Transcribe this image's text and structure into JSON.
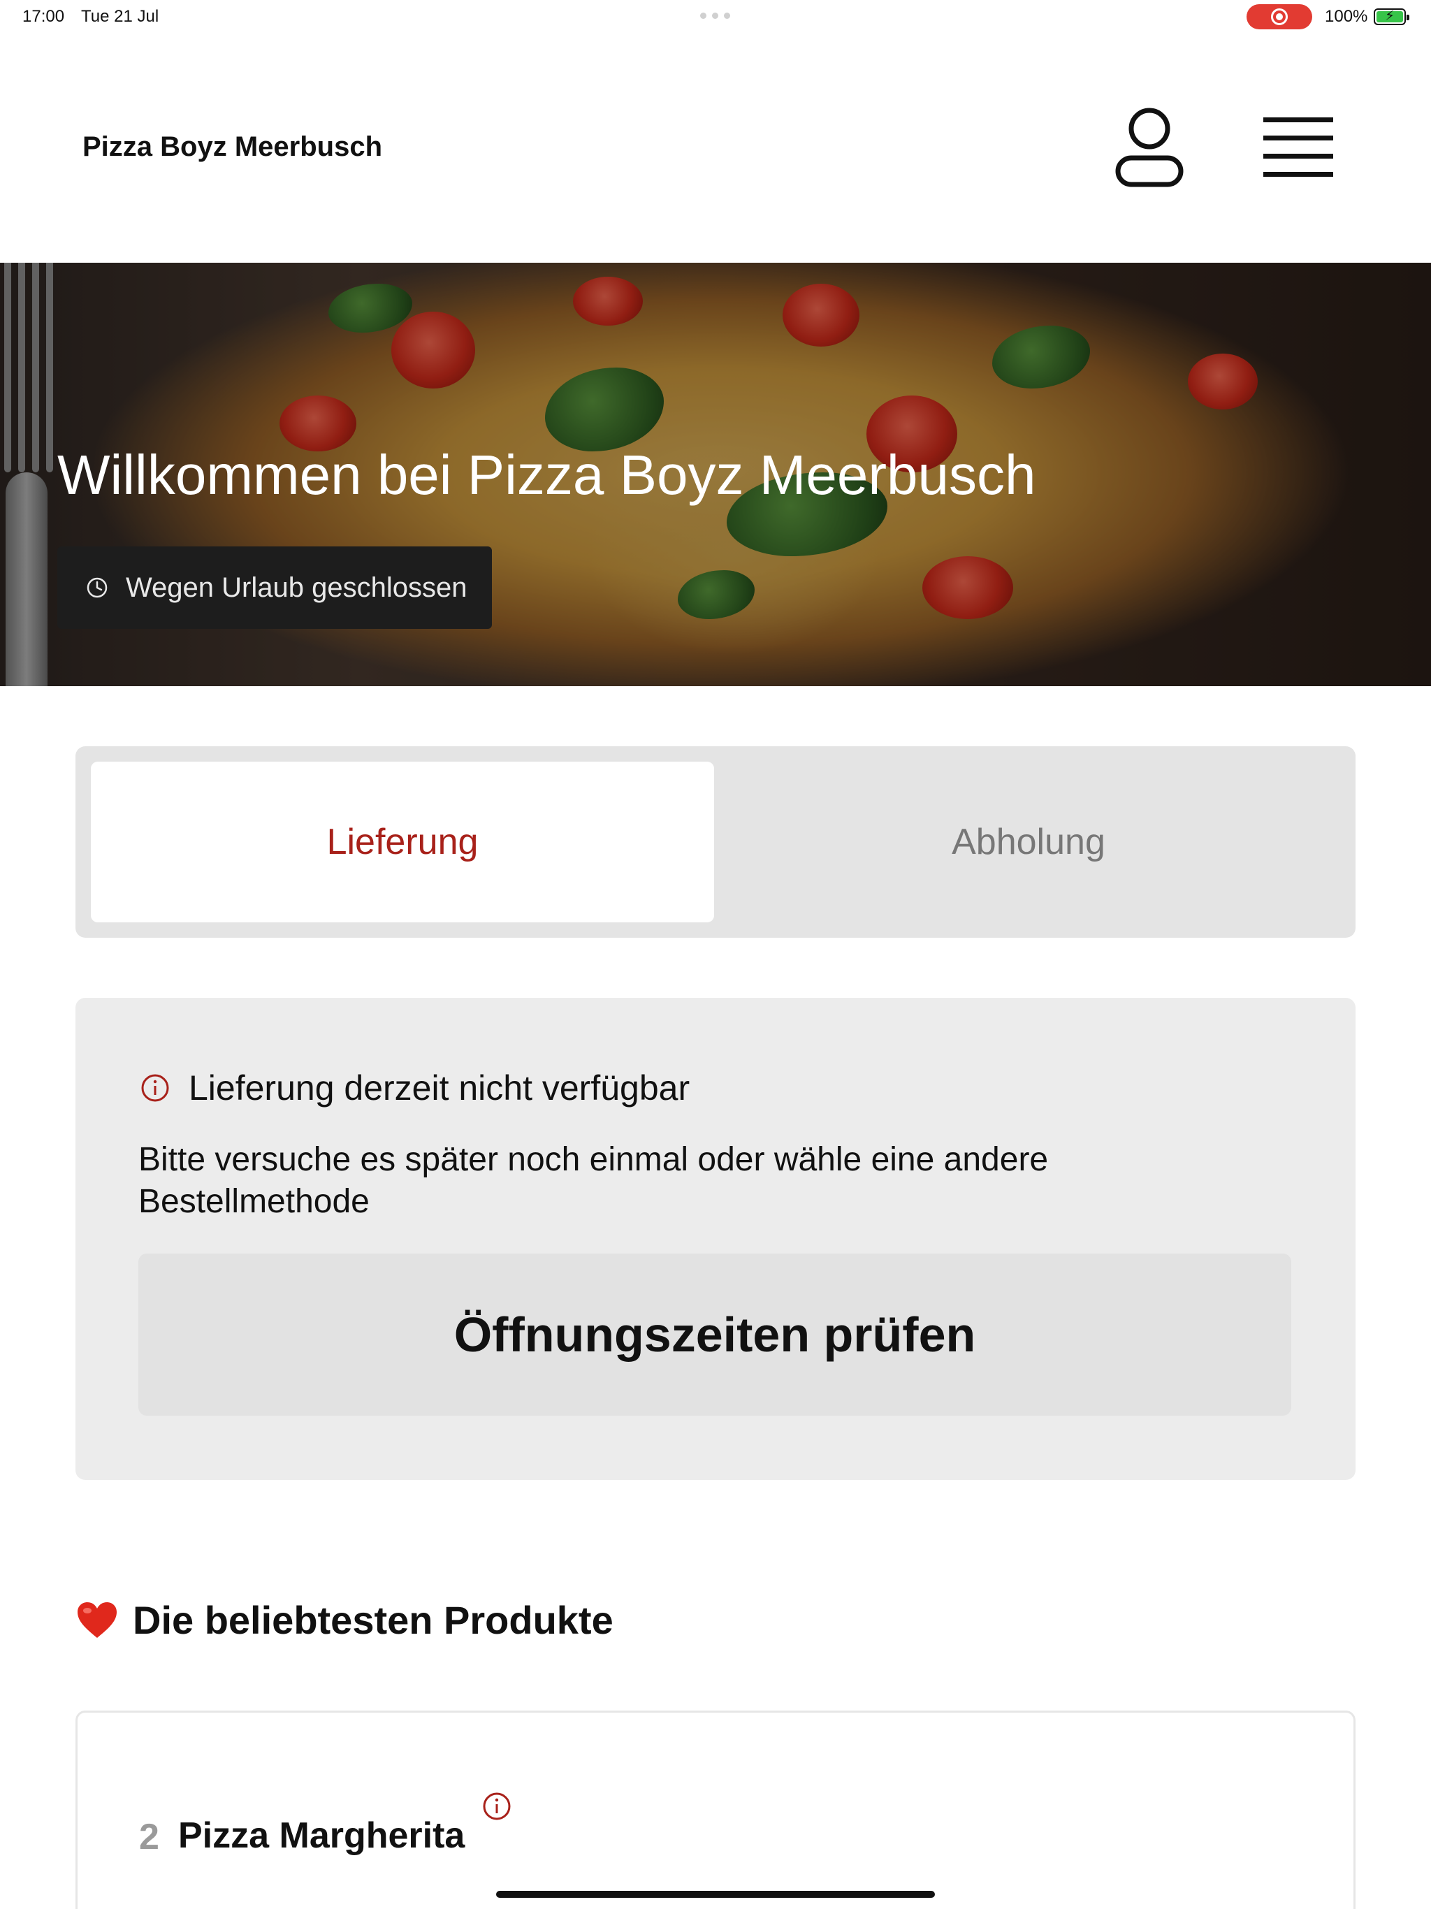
{
  "status_bar": {
    "time": "17:00",
    "date": "Tue 21 Jul",
    "battery": "100%"
  },
  "header": {
    "brand": "Pizza Boyz Meerbusch",
    "icons": [
      "user-icon",
      "hamburger-menu-icon"
    ]
  },
  "hero": {
    "title": "Willkommen bei Pizza Boyz Meerbusch",
    "status": "Wegen Urlaub geschlossen",
    "status_icon": "clock-icon"
  },
  "order_modes": {
    "tabs": [
      {
        "label": "Lieferung",
        "selected": true
      },
      {
        "label": "Abholung",
        "selected": false
      }
    ]
  },
  "notice": {
    "icon": "info-icon",
    "title": "Lieferung derzeit nicht verfügbar",
    "body": "Bitte versuche es später noch einmal oder wähle eine andere Bestellmethode",
    "button": "Öffnungszeiten prüfen"
  },
  "popular": {
    "icon": "heart-icon",
    "title": "Die beliebtesten Produkte",
    "products": [
      {
        "number": "2",
        "name": "Pizza Margherita",
        "icon": "info-icon"
      }
    ]
  },
  "colors": {
    "accent": "#a8211a",
    "recording": "#e23b32",
    "battery": "#37c449"
  }
}
